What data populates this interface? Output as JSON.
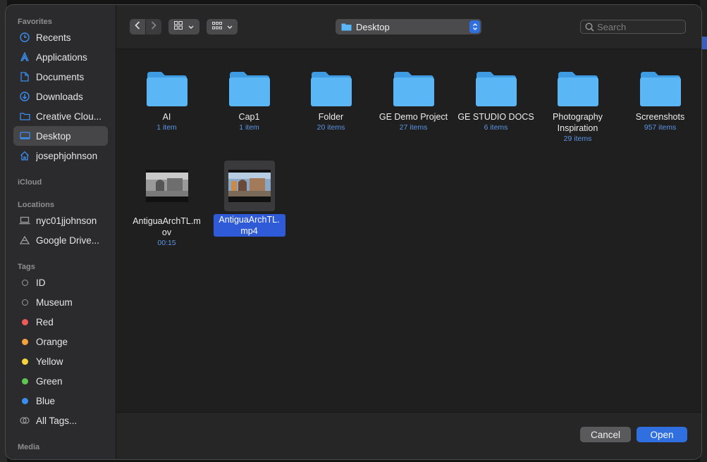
{
  "sidebar": {
    "favorites_header": "Favorites",
    "favorites": [
      {
        "label": "Recents",
        "icon": "clock-icon"
      },
      {
        "label": "Applications",
        "icon": "applications-icon"
      },
      {
        "label": "Documents",
        "icon": "document-icon"
      },
      {
        "label": "Downloads",
        "icon": "download-icon"
      },
      {
        "label": "Creative Clou...",
        "icon": "folder-icon"
      },
      {
        "label": "Desktop",
        "icon": "desktop-icon",
        "selected": true
      },
      {
        "label": "josephjohnson",
        "icon": "home-icon"
      }
    ],
    "icloud_header": "iCloud",
    "locations_header": "Locations",
    "locations": [
      {
        "label": "nyc01jjohnson",
        "icon": "laptop-icon"
      },
      {
        "label": "Google Drive...",
        "icon": "drive-icon"
      }
    ],
    "tags_header": "Tags",
    "tags": [
      {
        "label": "ID",
        "color": ""
      },
      {
        "label": "Museum",
        "color": ""
      },
      {
        "label": "Red",
        "color": "#ec5b56"
      },
      {
        "label": "Orange",
        "color": "#f2a33a"
      },
      {
        "label": "Yellow",
        "color": "#f5d33a"
      },
      {
        "label": "Green",
        "color": "#5ec452"
      },
      {
        "label": "Blue",
        "color": "#3a8ef0"
      },
      {
        "label": "All Tags...",
        "color": "all"
      }
    ],
    "media_header": "Media"
  },
  "toolbar": {
    "location": "Desktop",
    "search_placeholder": "Search"
  },
  "files": [
    {
      "name": "AI",
      "meta": "1 item",
      "type": "folder"
    },
    {
      "name": "Cap1",
      "meta": "1 item",
      "type": "folder"
    },
    {
      "name": "Folder",
      "meta": "20 items",
      "type": "folder"
    },
    {
      "name": "GE Demo Project",
      "meta": "27 items",
      "type": "folder"
    },
    {
      "name": "GE STUDIO DOCS",
      "meta": "6 items",
      "type": "folder"
    },
    {
      "name": "Photography Inspiration",
      "meta": "29 items",
      "type": "folder"
    },
    {
      "name": "Screenshots",
      "meta": "957 items",
      "type": "folder"
    },
    {
      "name": "AntiguaArchTL.mov",
      "meta": "00:15",
      "type": "video"
    },
    {
      "name": "AntiguaArchTL.mp4",
      "meta": "",
      "type": "video",
      "selected": true
    }
  ],
  "footer": {
    "cancel_label": "Cancel",
    "open_label": "Open"
  },
  "colors": {
    "accent": "#2f6fe0",
    "folder": "#5bb6f5"
  }
}
